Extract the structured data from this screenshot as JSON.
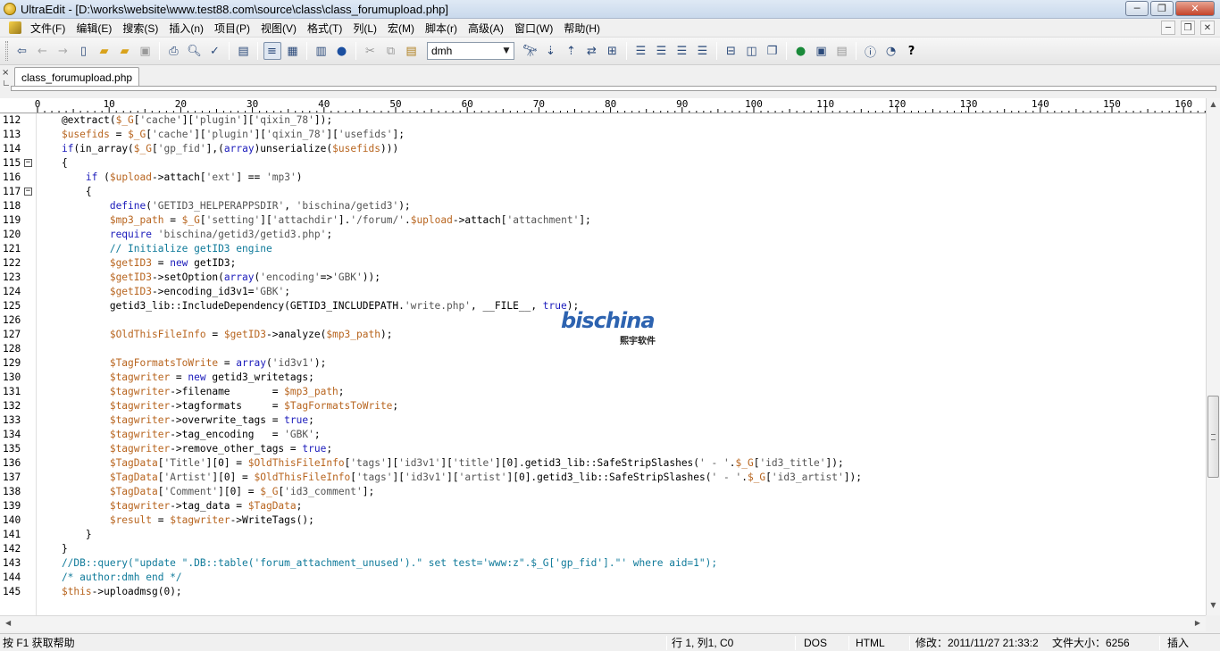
{
  "window": {
    "title": "UltraEdit - [D:\\works\\website\\www.test88.com\\source\\class\\class_forumupload.php]",
    "minimize": "─",
    "maximize": "❐",
    "close": "✕"
  },
  "menu": {
    "items": [
      "文件(F)",
      "编辑(E)",
      "搜索(S)",
      "插入(n)",
      "项目(P)",
      "视图(V)",
      "格式(T)",
      "列(L)",
      "宏(M)",
      "脚本(r)",
      "高级(A)",
      "窗口(W)",
      "帮助(H)"
    ],
    "mdi_min": "─",
    "mdi_restore": "❐",
    "mdi_close": "✕"
  },
  "toolbar": {
    "combo_value": "dmh",
    "help_glyph": "?"
  },
  "tabs": {
    "close_glyph": "×",
    "active": "class_forumupload.php"
  },
  "ruler": {
    "labels": [
      "0",
      "10",
      "20",
      "30",
      "40",
      "50",
      "60",
      "70",
      "80",
      "90",
      "100",
      "110",
      "120",
      "130",
      "140",
      "150",
      "160"
    ]
  },
  "editor": {
    "lines": [
      {
        "n": "112",
        "fold": "",
        "code": "    @extract($_G['cache']['plugin']['qixin_78']);"
      },
      {
        "n": "113",
        "fold": "",
        "code": "    $usefids = $_G['cache']['plugin']['qixin_78']['usefids'];"
      },
      {
        "n": "114",
        "fold": "",
        "code": "    if(in_array($_G['gp_fid'],(array)unserialize($usefids)))"
      },
      {
        "n": "115",
        "fold": "−",
        "code": "    {"
      },
      {
        "n": "116",
        "fold": "",
        "code": "        if ($upload->attach['ext'] == 'mp3')"
      },
      {
        "n": "117",
        "fold": "−",
        "code": "        {"
      },
      {
        "n": "118",
        "fold": "",
        "code": "            define('GETID3_HELPERAPPSDIR', 'bischina/getid3');"
      },
      {
        "n": "119",
        "fold": "",
        "code": "            $mp3_path = $_G['setting']['attachdir'].'/forum/'.$upload->attach['attachment'];"
      },
      {
        "n": "120",
        "fold": "",
        "code": "            require 'bischina/getid3/getid3.php';"
      },
      {
        "n": "121",
        "fold": "",
        "code": "            // Initialize getID3 engine"
      },
      {
        "n": "122",
        "fold": "",
        "code": "            $getID3 = new getID3;"
      },
      {
        "n": "123",
        "fold": "",
        "code": "            $getID3->setOption(array('encoding'=>'GBK'));"
      },
      {
        "n": "124",
        "fold": "",
        "code": "            $getID3->encoding_id3v1='GBK';"
      },
      {
        "n": "125",
        "fold": "",
        "code": "            getid3_lib::IncludeDependency(GETID3_INCLUDEPATH.'write.php', __FILE__, true);"
      },
      {
        "n": "126",
        "fold": "",
        "code": ""
      },
      {
        "n": "127",
        "fold": "",
        "code": "            $OldThisFileInfo = $getID3->analyze($mp3_path);"
      },
      {
        "n": "128",
        "fold": "",
        "code": ""
      },
      {
        "n": "129",
        "fold": "",
        "code": "            $TagFormatsToWrite = array('id3v1');"
      },
      {
        "n": "130",
        "fold": "",
        "code": "            $tagwriter = new getid3_writetags;"
      },
      {
        "n": "131",
        "fold": "",
        "code": "            $tagwriter->filename       = $mp3_path;"
      },
      {
        "n": "132",
        "fold": "",
        "code": "            $tagwriter->tagformats     = $TagFormatsToWrite;"
      },
      {
        "n": "133",
        "fold": "",
        "code": "            $tagwriter->overwrite_tags = true;"
      },
      {
        "n": "134",
        "fold": "",
        "code": "            $tagwriter->tag_encoding   = 'GBK';"
      },
      {
        "n": "135",
        "fold": "",
        "code": "            $tagwriter->remove_other_tags = true;"
      },
      {
        "n": "136",
        "fold": "",
        "code": "            $TagData['Title'][0] = $OldThisFileInfo['tags']['id3v1']['title'][0].getid3_lib::SafeStripSlashes(' - '.$_G['id3_title']);"
      },
      {
        "n": "137",
        "fold": "",
        "code": "            $TagData['Artist'][0] = $OldThisFileInfo['tags']['id3v1']['artist'][0].getid3_lib::SafeStripSlashes(' - '.$_G['id3_artist']);"
      },
      {
        "n": "138",
        "fold": "",
        "code": "            $TagData['Comment'][0] = $_G['id3_comment'];"
      },
      {
        "n": "139",
        "fold": "",
        "code": "            $tagwriter->tag_data = $TagData;"
      },
      {
        "n": "140",
        "fold": "",
        "code": "            $result = $tagwriter->WriteTags();"
      },
      {
        "n": "141",
        "fold": "",
        "code": "        }"
      },
      {
        "n": "142",
        "fold": "",
        "code": "    }"
      },
      {
        "n": "143",
        "fold": "",
        "code": "    //DB::query(\"update \".DB::table('forum_attachment_unused').\" set test='www:z\".$_G['gp_fid'].\"' where aid=1\");"
      },
      {
        "n": "144",
        "fold": "",
        "code": "    /* author:dmh end */"
      },
      {
        "n": "145",
        "fold": "",
        "code": "    $this->uploadmsg(0);"
      }
    ]
  },
  "watermark": {
    "text": "bischina",
    "sub": "熙宇软件"
  },
  "statusbar": {
    "help": "按 F1 获取帮助",
    "position": "行 1, 列1, C0",
    "line_ending": "DOS",
    "file_type": "HTML",
    "modified": "修改：2011/11/27 21:33:2",
    "file_size": "文件大小：6256",
    "mode": "插入"
  }
}
